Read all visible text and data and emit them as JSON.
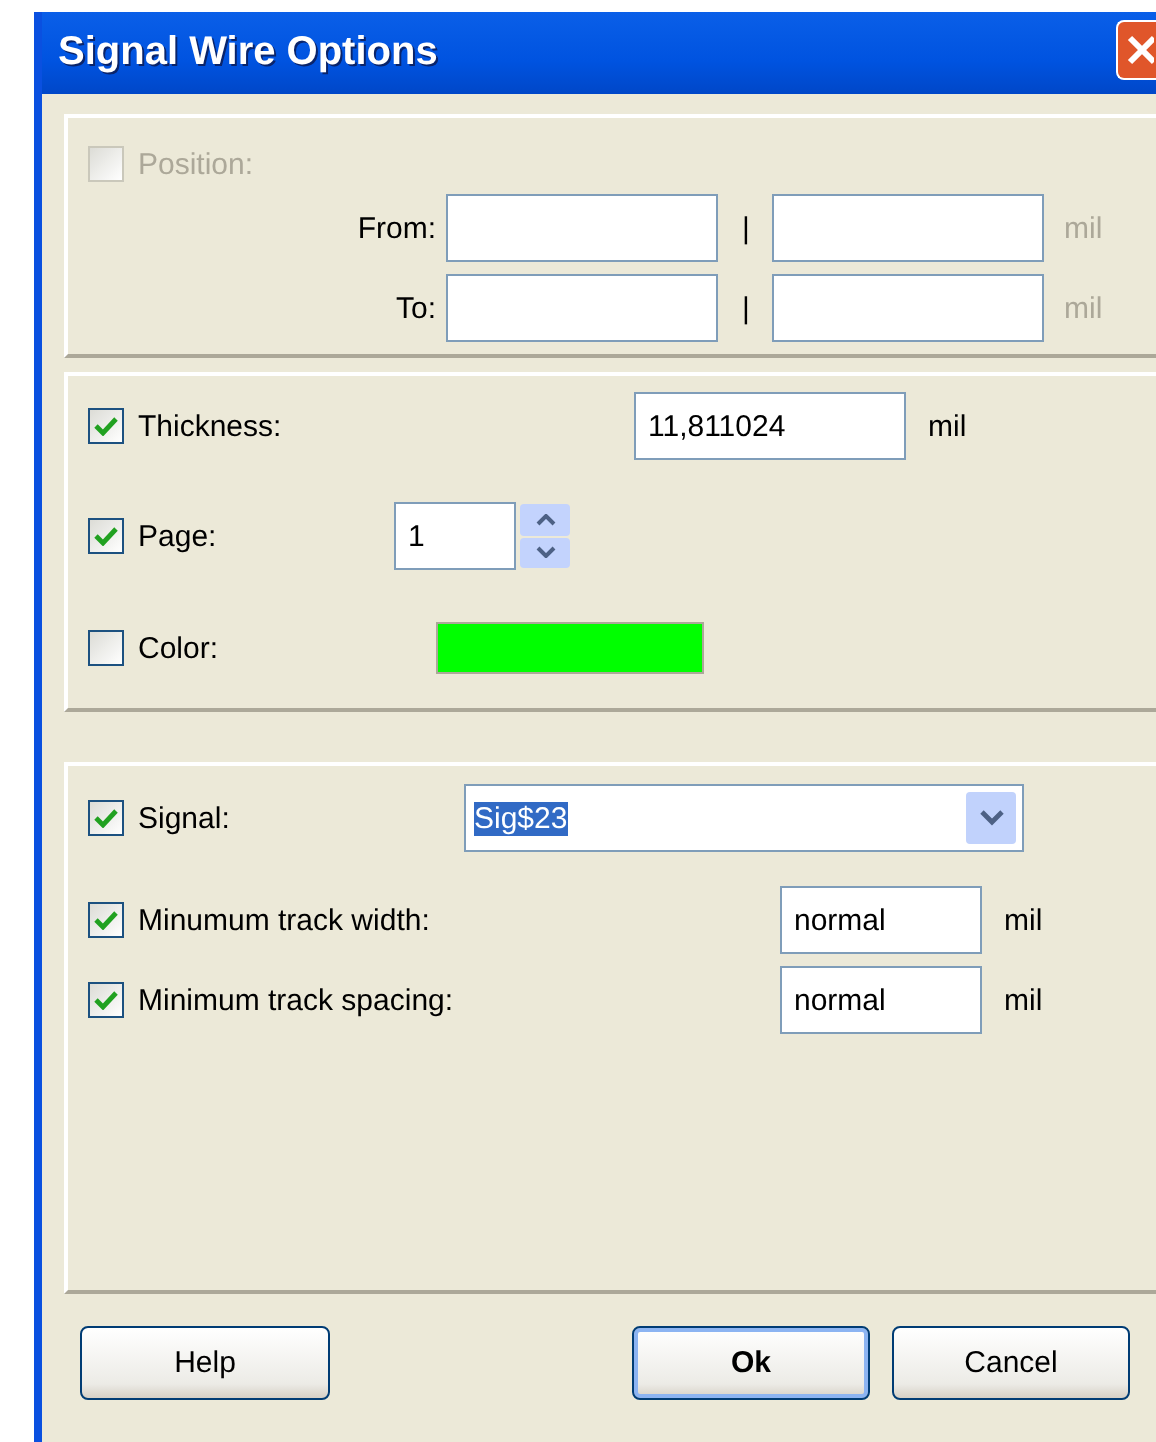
{
  "window": {
    "title": "Signal Wire Options"
  },
  "position": {
    "label": "Position:",
    "checked": false,
    "disabled": true,
    "rows": [
      {
        "label": "From:",
        "separator": "|",
        "unit": "mil"
      },
      {
        "label": "To:",
        "separator": "|",
        "unit": "mil"
      }
    ]
  },
  "thickness": {
    "label": "Thickness:",
    "checked": true,
    "value": "11,811024",
    "unit": "mil"
  },
  "page": {
    "label": "Page:",
    "checked": true,
    "value": "1"
  },
  "color": {
    "label": "Color:",
    "checked": false,
    "color": "#00ff00"
  },
  "signal": {
    "label": "Signal:",
    "checked": true,
    "value": "Sig$23",
    "selected": true
  },
  "tracks": [
    {
      "label": "Minumum track width:",
      "checked": true,
      "value": "normal",
      "unit": "mil"
    },
    {
      "label": "Minimum track spacing:",
      "checked": true,
      "value": "normal",
      "unit": "mil"
    }
  ],
  "buttons": [
    {
      "label": "Help",
      "default": false
    },
    {
      "label": "Ok",
      "default": true
    },
    {
      "label": "Cancel",
      "default": false
    }
  ]
}
